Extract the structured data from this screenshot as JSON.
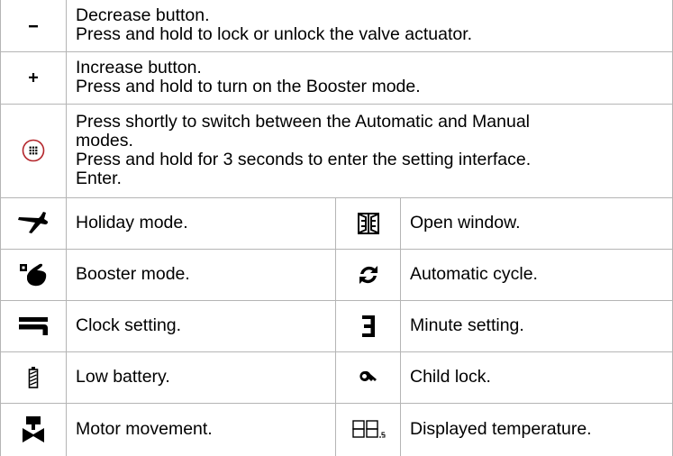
{
  "rows": [
    {
      "icon": "minus-icon",
      "lines": [
        "Decrease button.",
        "Press and hold to lock or unlock the valve actuator."
      ]
    },
    {
      "icon": "plus-icon",
      "lines": [
        "Increase button.",
        "Press and hold to turn on the Booster mode."
      ]
    },
    {
      "icon": "menu-button-icon",
      "lines": [
        "Press shortly to switch between the Automatic and Manual",
        "modes.",
        "Press and hold for 3 seconds to enter the setting interface.",
        "Enter."
      ]
    }
  ],
  "grid": [
    [
      {
        "icon": "airplane-icon",
        "label": "Holiday mode."
      },
      {
        "icon": "open-window-icon",
        "label": "Open window."
      }
    ],
    [
      {
        "icon": "booster-hand-icon",
        "label": "Booster mode."
      },
      {
        "icon": "cycle-arrows-icon",
        "label": "Automatic cycle."
      }
    ],
    [
      {
        "icon": "clock-setting-h-icon",
        "label": "Clock setting."
      },
      {
        "icon": "minute-setting-m-icon",
        "label": "Minute setting."
      }
    ],
    [
      {
        "icon": "low-battery-icon",
        "label": "Low battery."
      },
      {
        "icon": "key-icon",
        "label": "Child lock."
      }
    ],
    [
      {
        "icon": "valve-motor-icon",
        "label": "Motor movement."
      },
      {
        "icon": "seven-segment-88-icon",
        "label": "Displayed temperature."
      }
    ]
  ],
  "colors": {
    "border": "#b5b5b5",
    "text": "#000000",
    "menu_button_ring": "#b3242a"
  }
}
